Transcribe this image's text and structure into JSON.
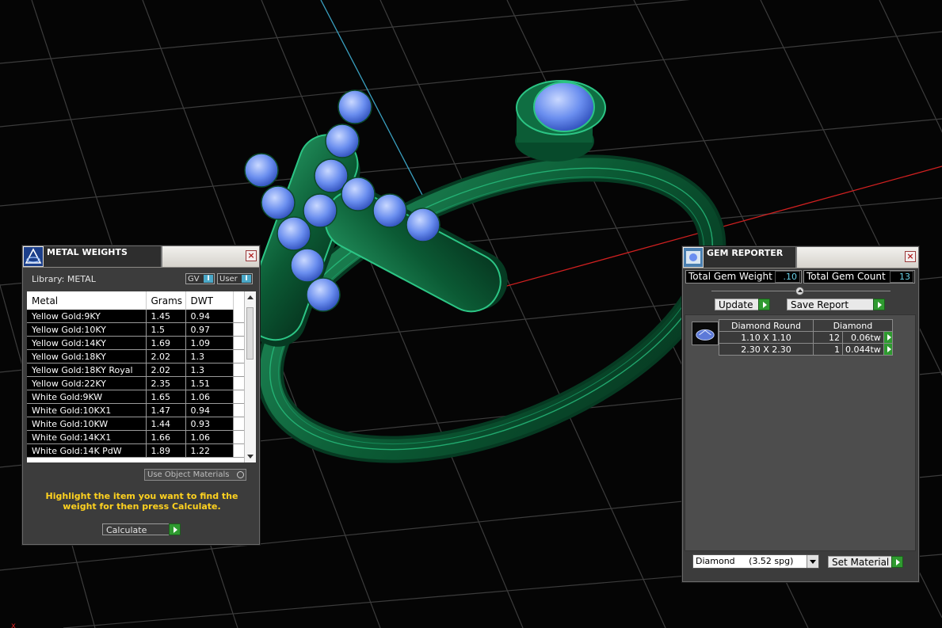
{
  "metal_weights": {
    "title": "METAL WEIGHTS",
    "library": "Library: METAL",
    "toggle_gv": "GV",
    "toggle_user": "User",
    "columns": [
      "Metal",
      "Grams",
      "DWT"
    ],
    "rows": [
      [
        "Yellow Gold:9KY",
        "1.45",
        "0.94"
      ],
      [
        "Yellow Gold:10KY",
        "1.5",
        "0.97"
      ],
      [
        "Yellow Gold:14KY",
        "1.69",
        "1.09"
      ],
      [
        "Yellow Gold:18KY",
        "2.02",
        "1.3"
      ],
      [
        "Yellow Gold:18KY Royal",
        "2.02",
        "1.3"
      ],
      [
        "Yellow Gold:22KY",
        "2.35",
        "1.51"
      ],
      [
        "White Gold:9KW",
        "1.65",
        "1.06"
      ],
      [
        "White Gold:10KX1",
        "1.47",
        "0.94"
      ],
      [
        "White Gold:10KW",
        "1.44",
        "0.93"
      ],
      [
        "White Gold:14KX1",
        "1.66",
        "1.06"
      ],
      [
        "White Gold:14K PdW",
        "1.89",
        "1.22"
      ]
    ],
    "use_object_materials": "Use Object Materials",
    "hint": "Highlight the item you want to find the weight for then press Calculate.",
    "calculate_label": "Calculate"
  },
  "gem_reporter": {
    "title": "GEM REPORTER",
    "total_weight_label": "Total Gem Weight",
    "total_weight_value": ".10",
    "total_count_label": "Total Gem Count",
    "total_count_value": "13",
    "update_label": "Update",
    "save_report_label": "Save Report",
    "table_header": [
      "Diamond Round",
      "Diamond"
    ],
    "rows": [
      [
        "1.10 X 1.10",
        "12",
        "0.06tw"
      ],
      [
        "2.30 X 2.30",
        "1",
        "0.044tw"
      ]
    ],
    "material_select": "Diamond     (3.52 spg)",
    "set_material_label": "Set Material"
  },
  "colors": {
    "metal": "#0f6b40",
    "gem": "#5a7fe0",
    "grid": "#3a3a3a",
    "hint": "#ffd21f",
    "accent_green": "#2f9a30"
  }
}
